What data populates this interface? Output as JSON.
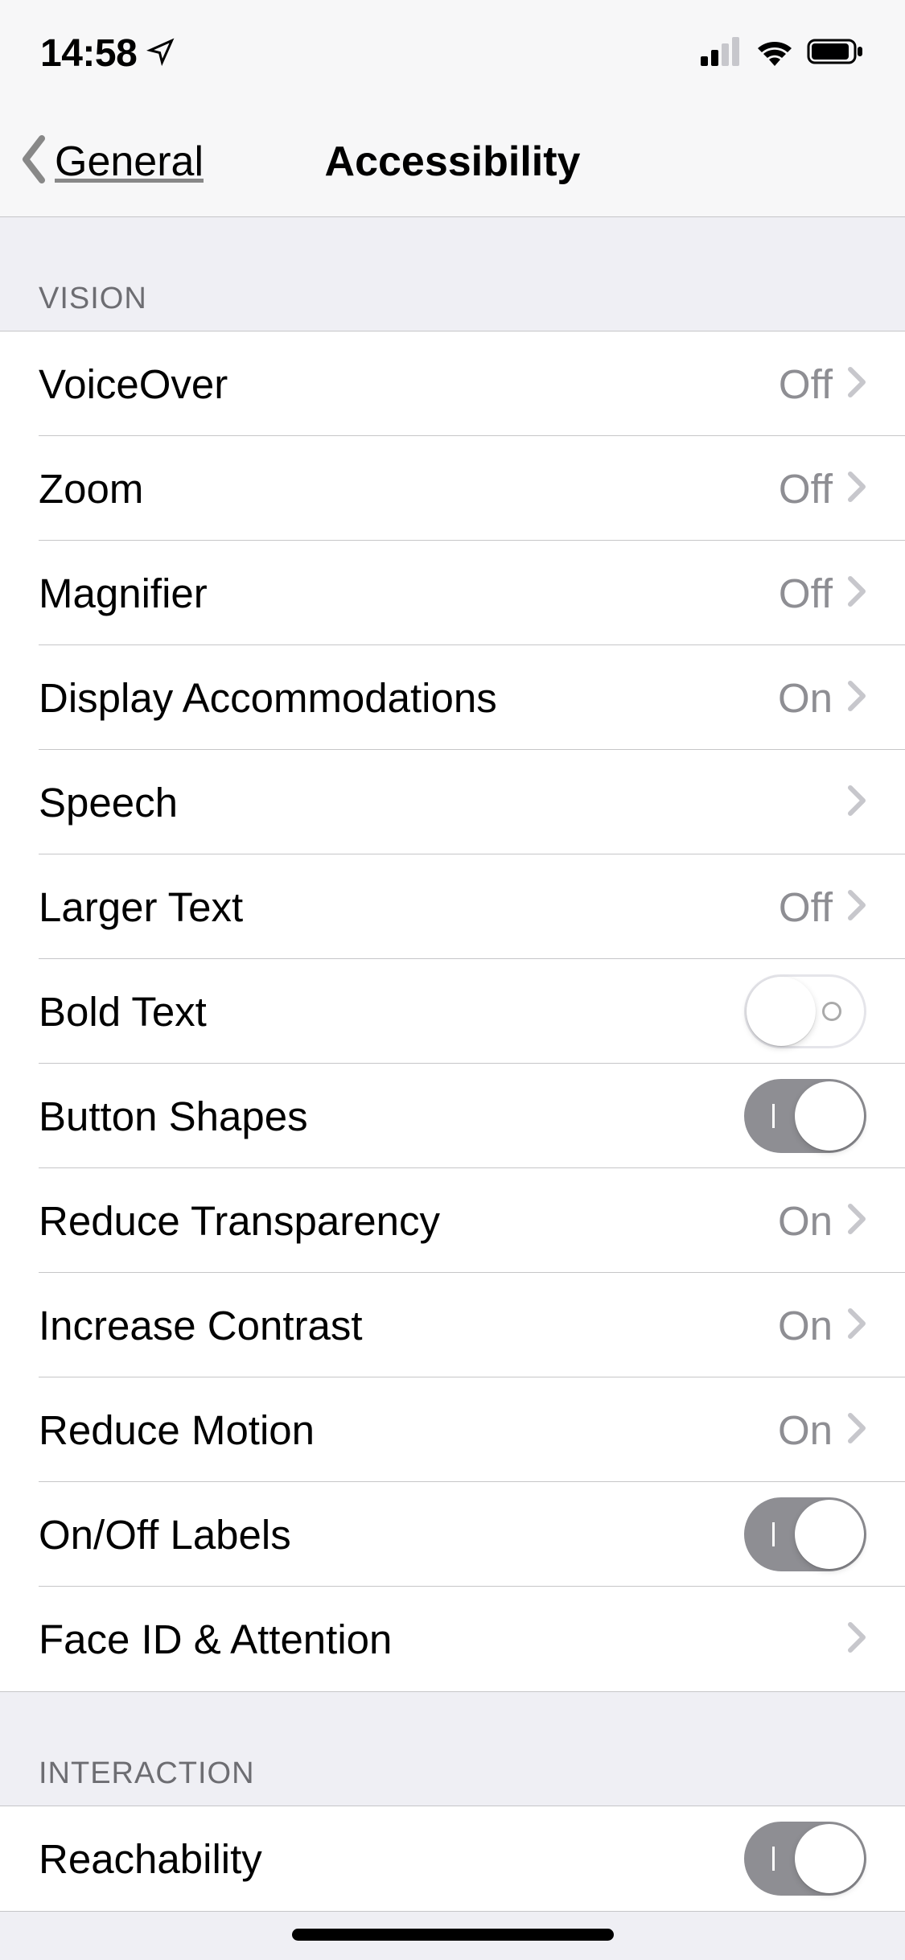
{
  "statusBar": {
    "time": "14:58"
  },
  "nav": {
    "backLabel": "General",
    "title": "Accessibility"
  },
  "sections": [
    {
      "header": "VISION",
      "items": [
        {
          "label": "VoiceOver",
          "value": "Off",
          "type": "disclosure"
        },
        {
          "label": "Zoom",
          "value": "Off",
          "type": "disclosure"
        },
        {
          "label": "Magnifier",
          "value": "Off",
          "type": "disclosure"
        },
        {
          "label": "Display Accommodations",
          "value": "On",
          "type": "disclosure"
        },
        {
          "label": "Speech",
          "value": "",
          "type": "disclosure"
        },
        {
          "label": "Larger Text",
          "value": "Off",
          "type": "disclosure"
        },
        {
          "label": "Bold Text",
          "type": "switch",
          "on": false
        },
        {
          "label": "Button Shapes",
          "type": "switch",
          "on": true
        },
        {
          "label": "Reduce Transparency",
          "value": "On",
          "type": "disclosure"
        },
        {
          "label": "Increase Contrast",
          "value": "On",
          "type": "disclosure"
        },
        {
          "label": "Reduce Motion",
          "value": "On",
          "type": "disclosure"
        },
        {
          "label": "On/Off Labels",
          "type": "switch",
          "on": true
        },
        {
          "label": "Face ID & Attention",
          "value": "",
          "type": "disclosure"
        }
      ]
    },
    {
      "header": "INTERACTION",
      "items": [
        {
          "label": "Reachability",
          "type": "switch",
          "on": true
        }
      ]
    }
  ]
}
